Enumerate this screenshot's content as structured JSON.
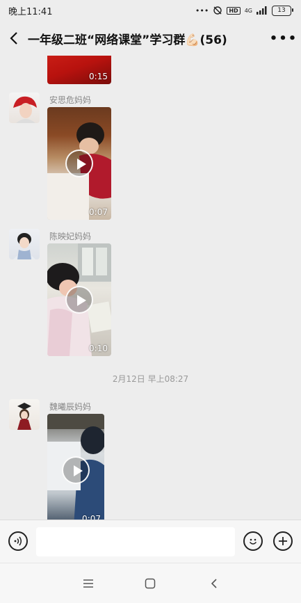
{
  "status_bar": {
    "time": "晚上11:41",
    "network": "4G",
    "hd": "HD",
    "battery": "13"
  },
  "header": {
    "title": "一年级二班“网络课堂”学习群💪🏻(56)",
    "back_icon": "back-chevron-icon",
    "more_icon": "more-dots-icon"
  },
  "messages": [
    {
      "sender": "",
      "duration": "0:15"
    },
    {
      "sender": "安思危妈妈",
      "duration": "0:07"
    },
    {
      "sender": "陈映妃妈妈",
      "duration": "0:10"
    },
    {
      "sender": "魏曦辰妈妈",
      "duration": "0:07"
    }
  ],
  "timestamp": "2月12日 早上08:27",
  "input_bar": {
    "voice_icon": "voice-icon",
    "emoji_icon": "emoji-icon",
    "plus_icon": "plus-icon"
  },
  "system_nav": {
    "menu_icon": "menu-icon",
    "home_icon": "home-icon",
    "back_icon": "back-icon"
  }
}
